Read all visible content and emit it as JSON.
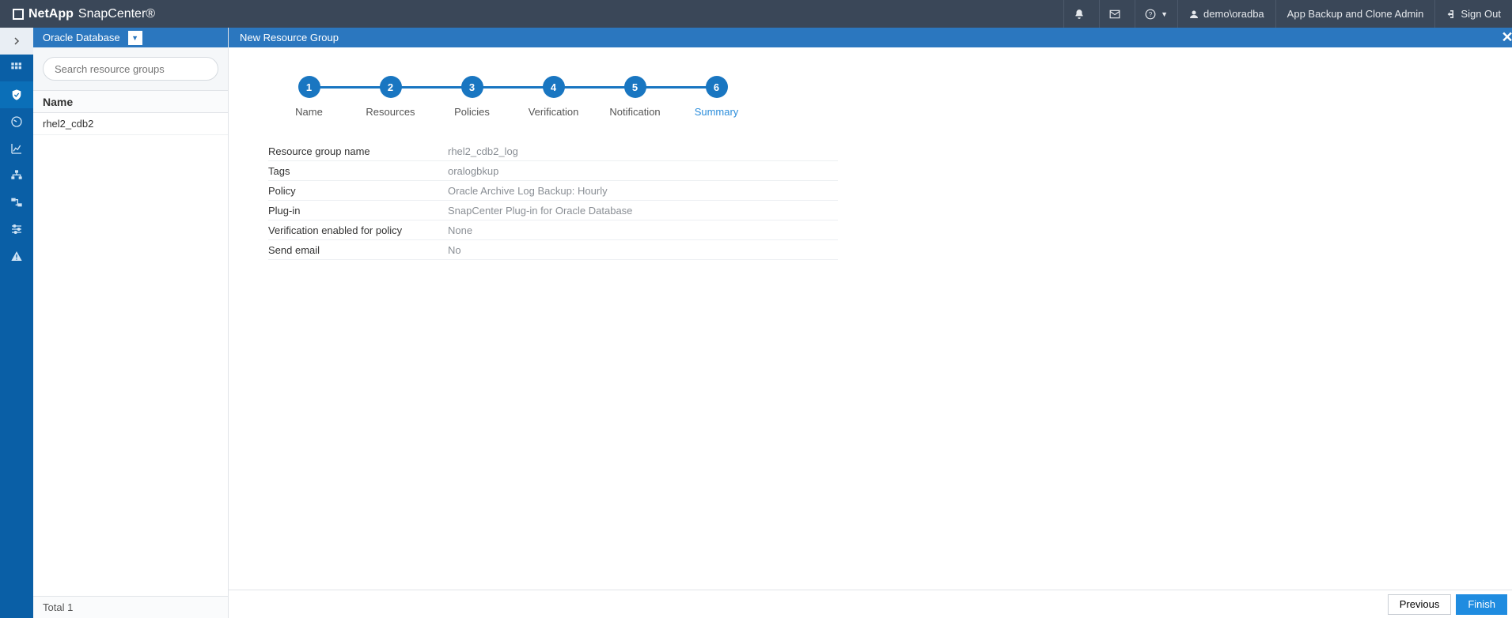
{
  "header": {
    "brand_a": "NetApp",
    "brand_b": "SnapCenter®",
    "user": "demo\\oradba",
    "role": "App Backup and Clone Admin",
    "signout": "Sign Out"
  },
  "list": {
    "crumb": "Oracle Database",
    "search_placeholder": "Search resource groups",
    "header": "Name",
    "rows": [
      "rhel2_cdb2"
    ],
    "total_label": "Total 1"
  },
  "wizard": {
    "title": "New Resource Group",
    "steps": [
      {
        "n": "1",
        "label": "Name"
      },
      {
        "n": "2",
        "label": "Resources"
      },
      {
        "n": "3",
        "label": "Policies"
      },
      {
        "n": "4",
        "label": "Verification"
      },
      {
        "n": "5",
        "label": "Notification"
      },
      {
        "n": "6",
        "label": "Summary"
      }
    ],
    "active_step_index": 5,
    "summary": [
      {
        "k": "Resource group name",
        "v": "rhel2_cdb2_log"
      },
      {
        "k": "Tags",
        "v": "oralogbkup"
      },
      {
        "k": "Policy",
        "v": "Oracle Archive Log Backup: Hourly"
      },
      {
        "k": "Plug-in",
        "v": "SnapCenter Plug-in for Oracle Database"
      },
      {
        "k": "Verification enabled for policy",
        "v": "None"
      },
      {
        "k": "Send email",
        "v": "No"
      }
    ],
    "buttons": {
      "prev": "Previous",
      "finish": "Finish"
    }
  },
  "colors": {
    "brand_blue": "#1f8ce0",
    "rail_blue": "#0a5fa6",
    "header_dark": "#3a4758"
  }
}
